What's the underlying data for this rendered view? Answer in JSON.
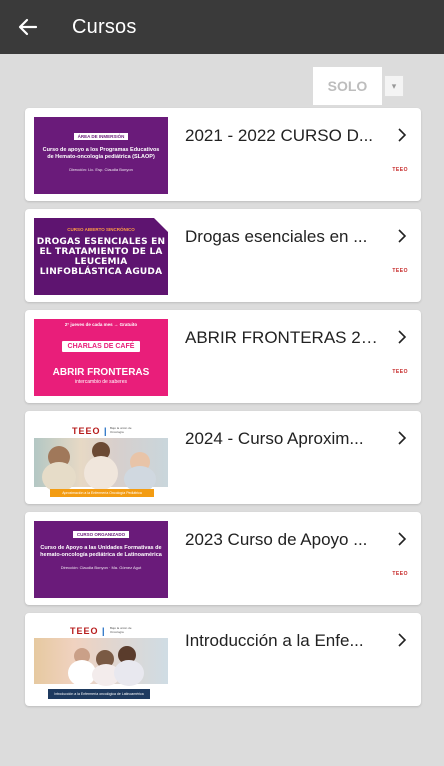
{
  "appbar": {
    "title": "Cursos",
    "back_icon": "arrow-left-icon"
  },
  "filter": {
    "label": "SOLO",
    "toggle": "▾"
  },
  "courses": [
    {
      "title": "2021 - 2022 CURSO D...",
      "thumb": {
        "tag": "ÁREA DE INMERSIÓN",
        "heading": "Curso de apoyo a los Programas Educativos de Hemato-oncología pediátrica (SLAOP)",
        "note": "Dirección: Lic. Esp. Claudia Bonyon"
      },
      "logo": "TEEO"
    },
    {
      "title": "Drogas esenciales en ...",
      "thumb": {
        "tag": "CURSO ABIERTO SINCRÓNICO",
        "heading": "DROGAS ESENCIALES EN EL TRATAMIENTO DE LA LEUCEMIA LINFOBLÁSTICA AGUDA"
      },
      "logo": "TEEO"
    },
    {
      "title": "ABRIR FRONTERAS  20...",
      "thumb": {
        "top": "2° jueves de cada mes → Gratuito",
        "badge": "CHARLAS DE CAFÉ",
        "heading": "ABRIR FRONTERAS",
        "note": "intercambio de saberes"
      },
      "logo": "TEEO"
    },
    {
      "title": "2024 - Curso Aproxim...",
      "thumb": {
        "logo": "TEEO",
        "logo_tail": "|",
        "sub": "Bajo la unión de Oncología",
        "bar": "Aproximación a la Enfermería Oncología Pediátrica"
      },
      "logo": ""
    },
    {
      "title": "2023 Curso de Apoyo ...",
      "thumb": {
        "tag": "CURSO ORGANIZADO",
        "heading": "Curso de Apoyo a las Unidades Formativas de hemato-oncología pediátrica de Latinoamérica",
        "note": "Dirección: Claudia Bonyon · Ma. Gómez Agut"
      },
      "logo": "TEEO"
    },
    {
      "title": "Introducción a la Enfe...",
      "thumb": {
        "logo": "TEEO",
        "logo_tail": "|",
        "sub": "Bajo la unión de Oncología",
        "bar": "Introducción a la Enfermería oncológica de Latinoamérica"
      },
      "logo": ""
    }
  ],
  "colors": {
    "appbar": "#3a3a3a",
    "background": "#dcdcdc",
    "purple": "#6a1b7a",
    "pink": "#e91e7a",
    "orange": "#f39c12"
  }
}
